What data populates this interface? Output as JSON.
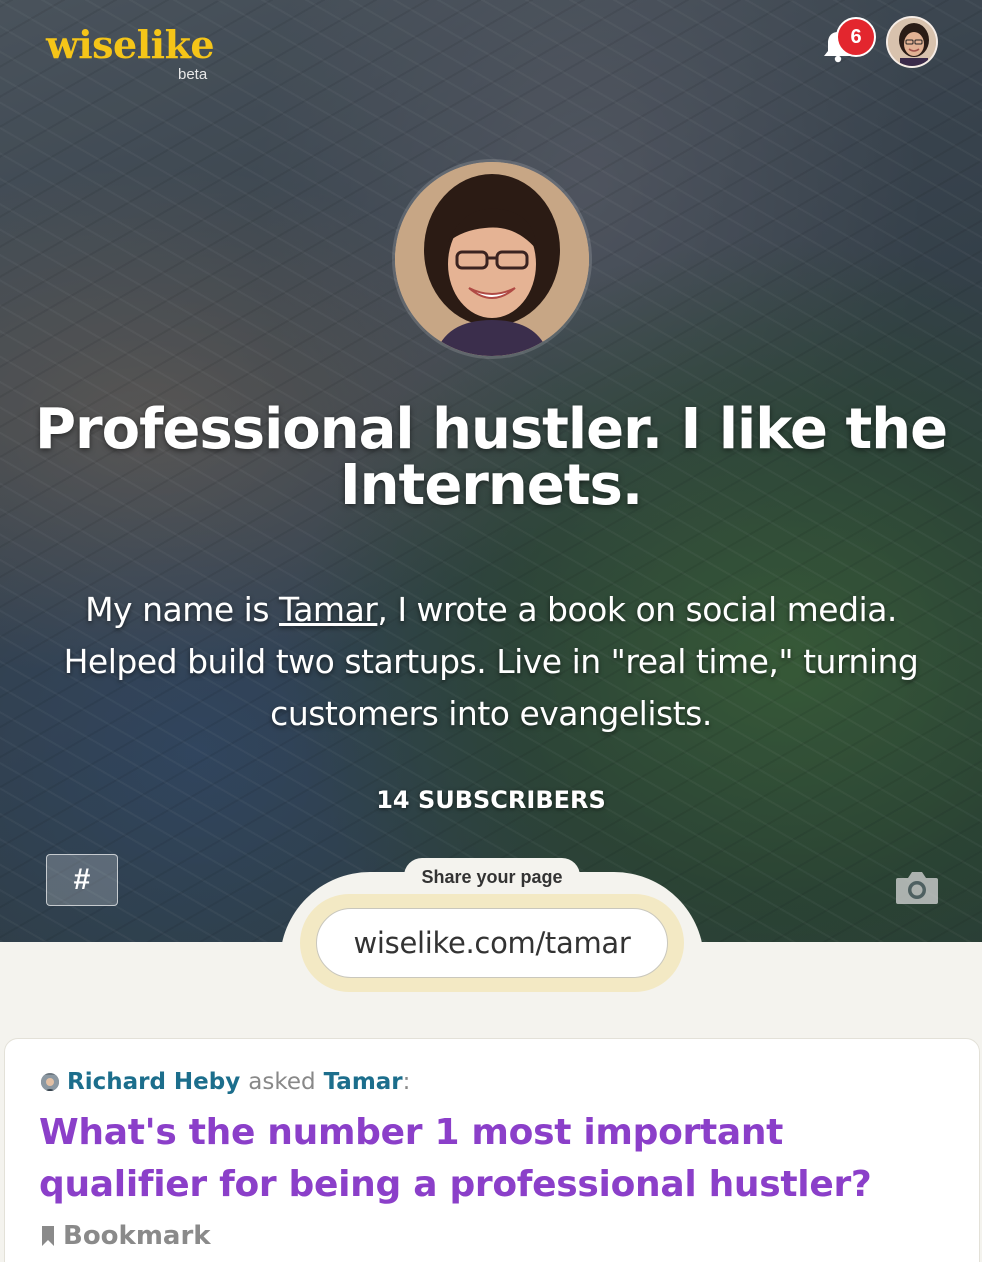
{
  "header": {
    "logo": "wiselike",
    "logo_tag": "beta",
    "notifications_count": "6"
  },
  "profile": {
    "headline": "Professional hustler. I like the Internets.",
    "bio_prefix": "My name is ",
    "bio_name": "Tamar",
    "bio_suffix": ", I wrote a book on social media. Helped build two startups. Live in \"real time,\" turning customers into evangelists.",
    "subscribers": "14 SUBSCRIBERS",
    "hashtag_button": "#"
  },
  "share": {
    "label": "Share your page",
    "url": "wiselike.com/tamar"
  },
  "question_card": {
    "asker": "Richard Heby",
    "asked_word": "asked",
    "askee": "Tamar",
    "colon": ":",
    "question": "What's the number 1 most important qualifier for being a professional hustler?",
    "bookmark_label": "Bookmark"
  },
  "colors": {
    "logo": "#f5c518",
    "badge": "#e3262e",
    "link_teal": "#1c6e8c",
    "question_purple": "#8b3fc9",
    "page_bg": "#f4f3ee"
  },
  "icons": [
    "bell-icon",
    "camera-icon",
    "bookmark-icon"
  ]
}
